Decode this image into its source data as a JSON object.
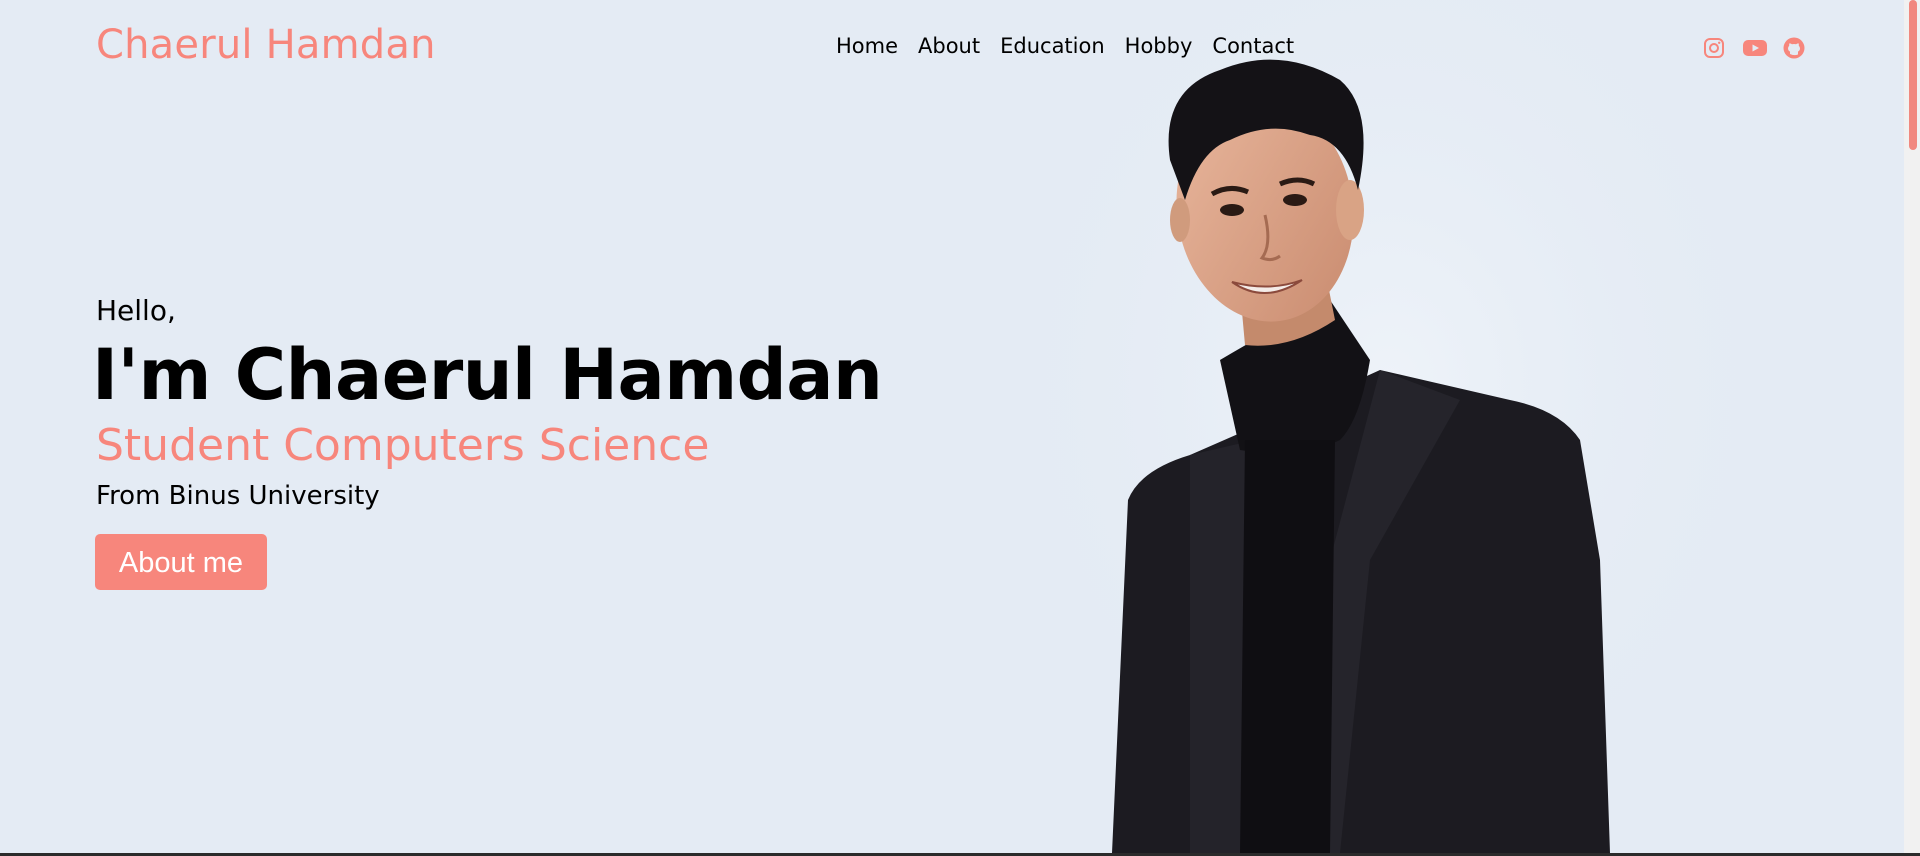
{
  "header": {
    "brand": "Chaerul Hamdan",
    "nav": [
      "Home",
      "About",
      "Education",
      "Hobby",
      "Contact"
    ],
    "socials": [
      "instagram-icon",
      "youtube-icon",
      "github-icon"
    ]
  },
  "hero": {
    "greeting": "Hello,",
    "name": "I'm Chaerul Hamdan",
    "role": "Student Computers Science",
    "origin": "From Binus University",
    "cta_label": "About me"
  },
  "colors": {
    "accent": "#f7867c",
    "background": "#e4ebf4",
    "text": "#000000"
  }
}
